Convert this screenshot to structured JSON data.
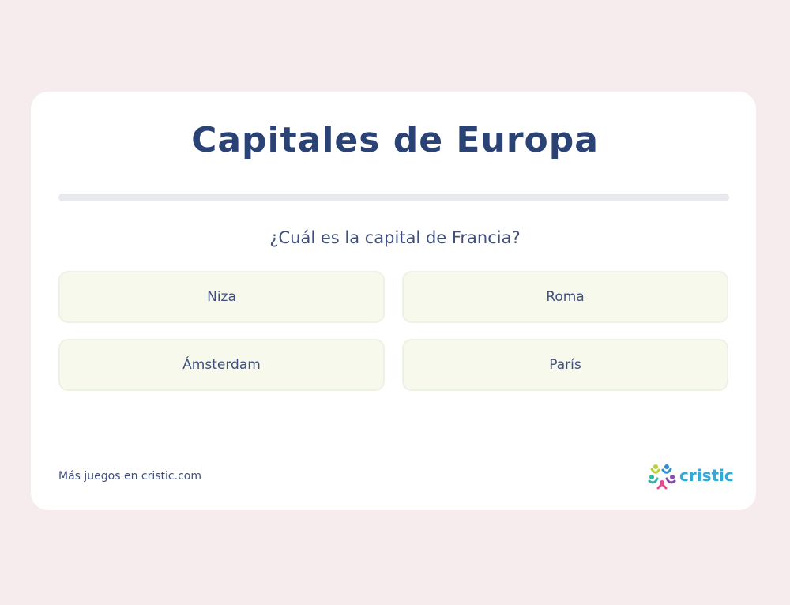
{
  "quiz": {
    "title": "Capitales de Europa",
    "progress": 0,
    "question": "¿Cuál es la capital de Francia?",
    "options": [
      "Niza",
      "Roma",
      "Ámsterdam",
      "París"
    ]
  },
  "footer": {
    "more_games_link": "Más juegos en cristic.com",
    "brand_name": "cristic"
  },
  "colors": {
    "background": "#f7eced",
    "card": "#ffffff",
    "title": "#2b4275",
    "text": "#3f5080",
    "option_bg": "#f8f9ed",
    "option_border": "#ebf2e6",
    "progress_track": "#e8e9ef",
    "brand": "#33a9d8"
  },
  "icons": {
    "brand_logo": "cristic-logo-icon"
  }
}
